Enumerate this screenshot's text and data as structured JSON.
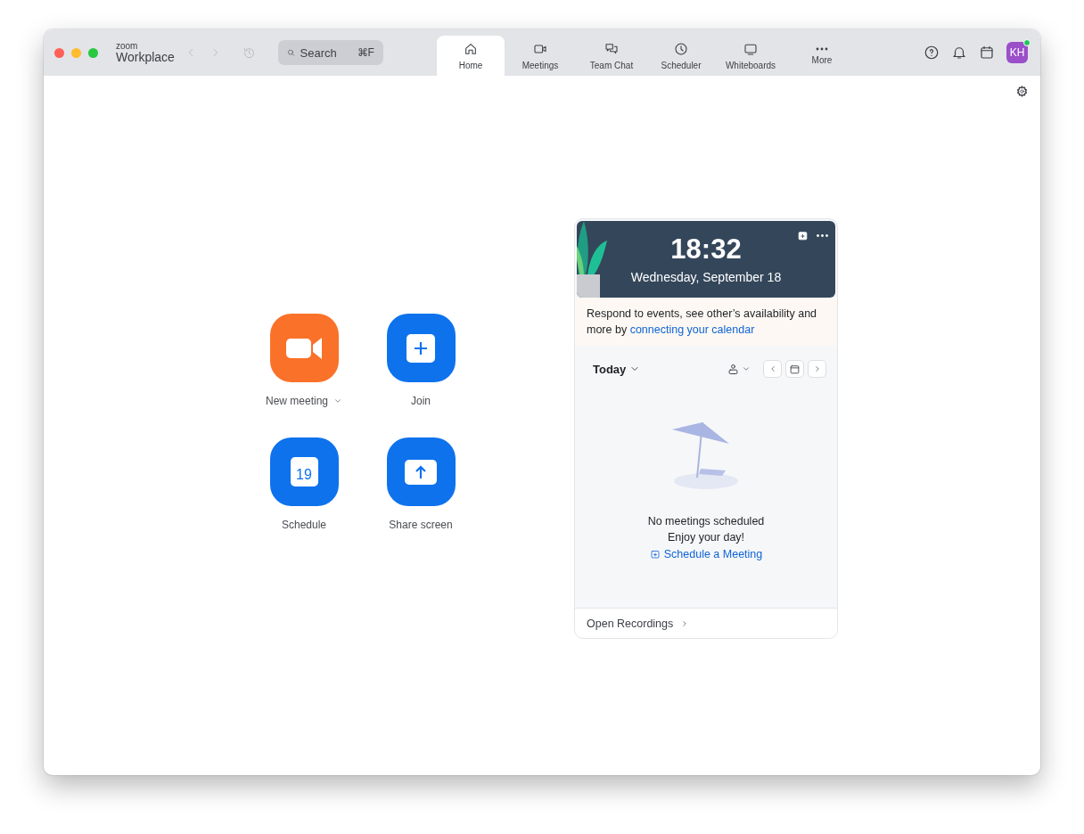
{
  "app": {
    "logo_small": "zoom",
    "logo_large": "Workplace"
  },
  "search": {
    "placeholder": "Search",
    "shortcut": "⌘F"
  },
  "tabs": [
    {
      "label": "Home",
      "selected": true
    },
    {
      "label": "Meetings",
      "selected": false
    },
    {
      "label": "Team Chat",
      "selected": false
    },
    {
      "label": "Scheduler",
      "selected": false
    },
    {
      "label": "Whiteboards",
      "selected": false
    },
    {
      "label": "More",
      "selected": false
    }
  ],
  "avatar": {
    "initials": "KH",
    "online": true
  },
  "actions": [
    {
      "label": "New meeting",
      "kind": "video",
      "has_menu": true
    },
    {
      "label": "Join",
      "kind": "plus",
      "has_menu": false
    },
    {
      "label": "Schedule",
      "kind": "calendar",
      "icon_text": "19",
      "has_menu": false
    },
    {
      "label": "Share screen",
      "kind": "share",
      "has_menu": false
    }
  ],
  "calendar_card": {
    "time": "18:32",
    "date": "Wednesday, September 18",
    "banner_text": "Respond to events, see other’s availability and more by ",
    "banner_link": "connecting your calendar",
    "day_selector": "Today",
    "empty_title": "No meetings scheduled",
    "empty_subtitle": "Enjoy your day!",
    "schedule_link": "Schedule a Meeting",
    "footer_link": "Open Recordings"
  }
}
